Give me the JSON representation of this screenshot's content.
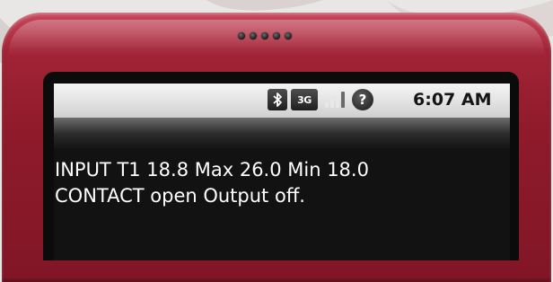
{
  "status_bar": {
    "icons": [
      "bluetooth-icon",
      "network-3g-icon",
      "signal-strength-icon",
      "help-icon"
    ],
    "network_label": "3G",
    "signal_bars_level": 3,
    "help_glyph": "?",
    "time": "6:07 AM"
  },
  "message": {
    "line1": "INPUT T1 18.8 Max 26.0 Min 18.0",
    "line2": "CONTACT open Output off."
  },
  "colors": {
    "phone_body": "#9b2234",
    "status_bar": "#e4e4e4",
    "screen": "#121212",
    "text": "#ffffff"
  }
}
